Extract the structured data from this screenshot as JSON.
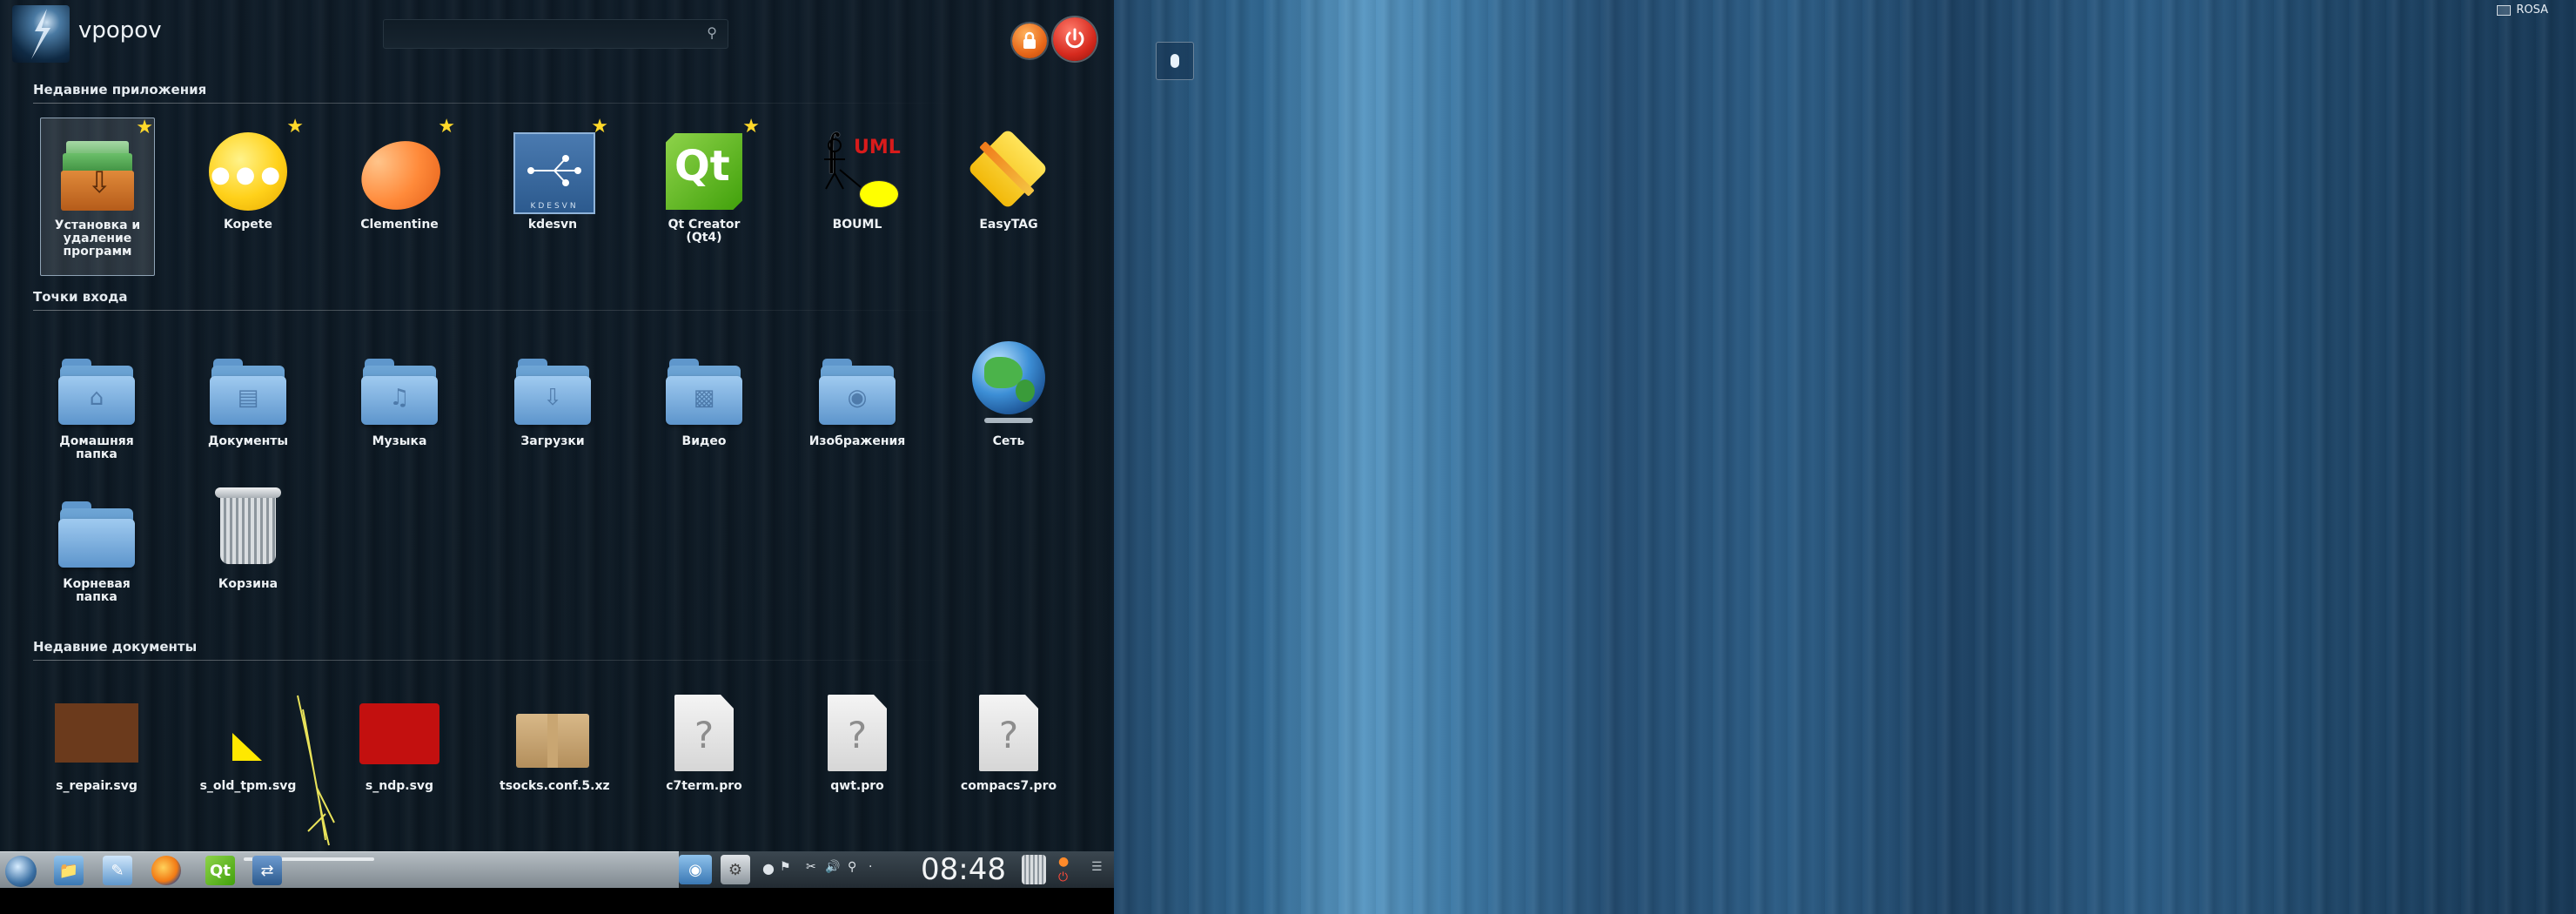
{
  "user": {
    "name": "vpopov"
  },
  "search": {
    "placeholder": ""
  },
  "sections": {
    "recent_apps": "Недавние приложения",
    "places": "Точки входа",
    "recent_docs": "Недавние документы"
  },
  "recent_apps": [
    {
      "label": "Установка и удаление программ",
      "icon": "package-install-icon",
      "starred": true
    },
    {
      "label": "Kopete",
      "icon": "kopete-icon",
      "starred": true
    },
    {
      "label": "Clementine",
      "icon": "clementine-icon",
      "starred": true
    },
    {
      "label": "kdesvn",
      "icon": "kdesvn-icon",
      "icon_text": "KDESVN",
      "starred": true
    },
    {
      "label": "Qt Creator (Qt4)",
      "icon": "qt-creator-icon",
      "icon_text": "Qt",
      "starred": true
    },
    {
      "label": "BOUML",
      "icon": "bouml-icon",
      "icon_text": "UML",
      "starred": false
    },
    {
      "label": "EasyTAG",
      "icon": "easytag-icon",
      "starred": false
    }
  ],
  "places": [
    {
      "label": "Домашняя папка",
      "icon": "home-folder-icon"
    },
    {
      "label": "Документы",
      "icon": "documents-folder-icon"
    },
    {
      "label": "Музыка",
      "icon": "music-folder-icon"
    },
    {
      "label": "Загрузки",
      "icon": "downloads-folder-icon"
    },
    {
      "label": "Видео",
      "icon": "video-folder-icon"
    },
    {
      "label": "Изображения",
      "icon": "pictures-folder-icon"
    },
    {
      "label": "Сеть",
      "icon": "network-globe-icon"
    },
    {
      "label": "Корневая папка",
      "icon": "root-folder-icon"
    },
    {
      "label": "Корзина",
      "icon": "trash-icon"
    }
  ],
  "recent_docs": [
    {
      "label": "s_repair.svg",
      "icon": "svg-preview-icon"
    },
    {
      "label": "s_old_tpm.svg",
      "icon": "svg-preview-icon"
    },
    {
      "label": "s_ndp.svg",
      "icon": "svg-preview-icon"
    },
    {
      "label": "tsocks.conf.5.xz",
      "icon": "archive-icon"
    },
    {
      "label": "c7term.pro",
      "icon": "unknown-file-icon"
    },
    {
      "label": "qwt.pro",
      "icon": "unknown-file-icon"
    },
    {
      "label": "compacs7.pro",
      "icon": "unknown-file-icon"
    }
  ],
  "taskbar": {
    "clock": "08:48",
    "apps": [
      "rosa-launcher-icon",
      "file-manager-icon",
      "text-editor-icon",
      "firefox-icon",
      "qt-creator-icon",
      "kdesvn-icon"
    ]
  },
  "desktop": {
    "corner_label": "ROSA"
  },
  "colors": {
    "lock_button": "#e8681a",
    "power_button": "#d62a1e",
    "star": "#ffd92a",
    "folder": "#7fb2e2"
  }
}
